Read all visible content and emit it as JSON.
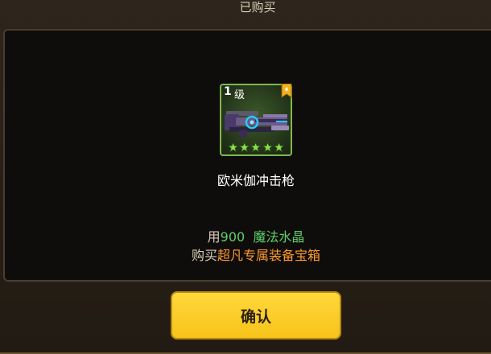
{
  "dialog": {
    "title": "已购买"
  },
  "item": {
    "level_number": "1",
    "level_unit": "级",
    "name": "欧米伽冲击枪",
    "rarity_stars": 5,
    "icon": "plasma-gun-icon",
    "badge_icon": "bookmark-badge-icon",
    "frame_color": "#7fb850"
  },
  "cost": {
    "prefix": "用",
    "amount": "900",
    "currency": "魔法水晶"
  },
  "purchase": {
    "prefix": "购买",
    "target": "超凡专属装备宝箱"
  },
  "buttons": {
    "confirm_label": "确认"
  },
  "colors": {
    "accent_green": "#5fd06a",
    "accent_orange": "#ff9a2e",
    "button_yellow": "#ffd83a"
  }
}
